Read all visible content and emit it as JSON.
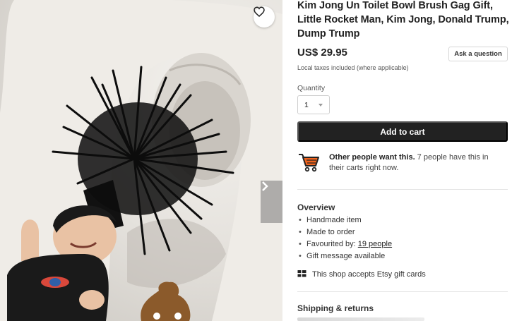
{
  "listing": {
    "title": "Kim Jong Un Toilet Bowl Brush Gag Gift, Little Rocket Man, Kim Jong, Donald Trump, Dump Trump",
    "price": "US$ 29.95",
    "ask_question_label": "Ask a question",
    "tax_note": "Local taxes included (where applicable)",
    "quantity_label": "Quantity",
    "quantity_value": "1",
    "add_to_cart_label": "Add to cart",
    "demand": {
      "bold": "Other people want this.",
      "text": " 7 people have this in their carts right now."
    }
  },
  "overview": {
    "title": "Overview",
    "items": [
      "Handmade item",
      "Made to order",
      "Favourited by: ",
      "Gift message available"
    ],
    "favourited_link": "19 people",
    "gift_cards": "This shop accepts Etsy gift cards"
  },
  "shipping": {
    "title": "Shipping & returns"
  },
  "icons": {
    "favourite": "heart-icon",
    "next": "chevron-right-icon",
    "cart": "shopping-cart-icon",
    "gift_card": "gift-card-icon"
  },
  "colors": {
    "button": "#222222",
    "button_text": "#ffffff",
    "text": "#222222",
    "muted": "#595959"
  }
}
